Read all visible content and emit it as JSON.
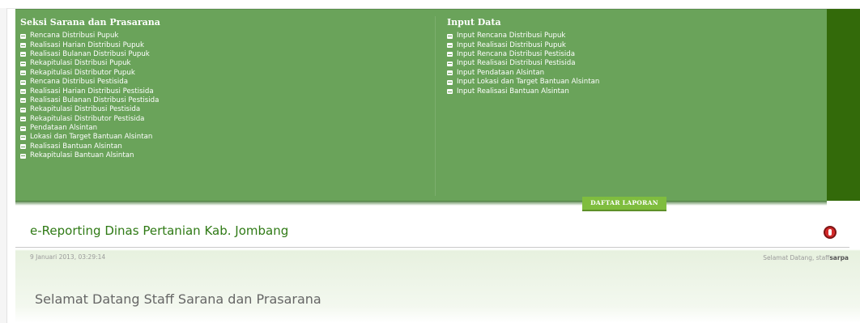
{
  "colors": {
    "panel_bg": "#6aa35a",
    "dark_strip": "#336a0a",
    "tab_bg": "#7fbd3e",
    "title_green": "#2f7a15",
    "alert_red": "#d42a2a"
  },
  "menu_panel": {
    "left_column": {
      "heading": "Seksi Sarana dan Prasarana",
      "items": [
        {
          "label": "Rencana Distribusi Pupuk"
        },
        {
          "label": "Realisasi Harian Distribusi Pupuk"
        },
        {
          "label": "Realisasi Bulanan Distribusi Pupuk"
        },
        {
          "label": "Rekapitulasi Distribusi Pupuk"
        },
        {
          "label": "Rekapitulasi Distributor Pupuk"
        },
        {
          "label": "Rencana Distribusi Pestisida"
        },
        {
          "label": "Realisasi Harian Distribusi Pestisida"
        },
        {
          "label": "Realisasi Bulanan Distribusi Pestisida"
        },
        {
          "label": "Rekapitulasi Distribusi Pestisida"
        },
        {
          "label": "Rekapitulasi Distributor Pestisida"
        },
        {
          "label": "Pendataan Alsintan"
        },
        {
          "label": "Lokasi dan Target Bantuan Alsintan"
        },
        {
          "label": "Realisasi Bantuan Alsintan"
        },
        {
          "label": "Rekapitulasi Bantuan Alsintan"
        }
      ]
    },
    "right_column": {
      "heading": "Input Data",
      "items": [
        {
          "label": "Input Rencana Distribusi Pupuk"
        },
        {
          "label": "Input Realisasi Distribusi Pupuk"
        },
        {
          "label": "Input Rencana Distribusi Pestisida"
        },
        {
          "label": "Input Realisasi Distribusi Pestisida"
        },
        {
          "label": "Input Pendataan Alsintan"
        },
        {
          "label": "Input Lokasi dan Target Bantuan Alsintan"
        },
        {
          "label": "Input Realisasi Bantuan Alsintan"
        }
      ]
    },
    "tab_label": "DAFTAR LAPORAN"
  },
  "header": {
    "site_title": "e-Reporting Dinas Pertanian Kab. Jombang",
    "datetime": "9 Januari 2013, 03:29:14",
    "welcome_prefix": "Selamat Datang, staff",
    "username": "sarpa",
    "alert_icon": "alert-icon"
  },
  "main": {
    "heading": "Selamat Datang Staff Sarana dan Prasarana"
  }
}
